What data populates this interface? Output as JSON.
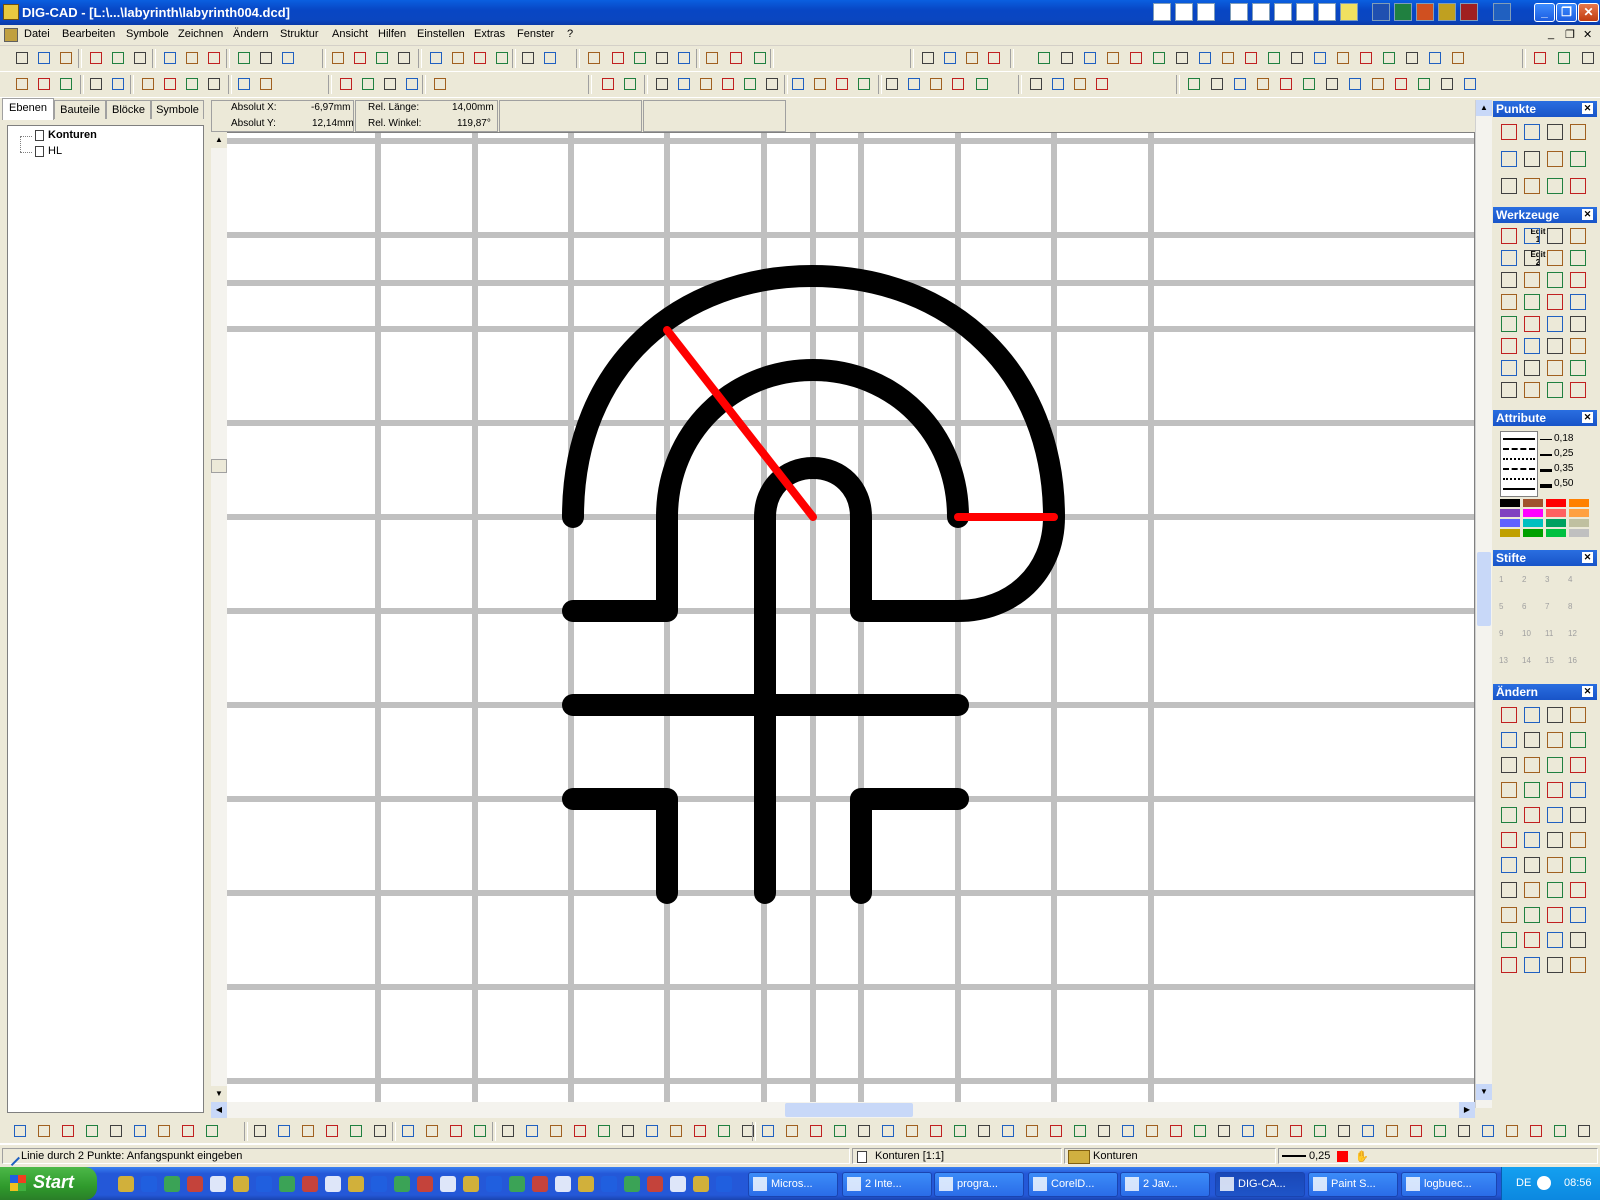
{
  "window": {
    "title": "DIG-CAD - [L:\\...\\labyrinth\\labyrinth004.dcd]",
    "controls": [
      "_",
      "❐",
      "✕"
    ]
  },
  "menu": [
    "Datei",
    "Bearbeiten",
    "Symbole",
    "Zeichnen",
    "Ändern",
    "Struktur",
    "Ansicht",
    "Hilfen",
    "Einstellen",
    "Extras",
    "Fenster",
    "?"
  ],
  "left_panel": {
    "tabs": [
      "Ebenen",
      "Bauteile",
      "Blöcke",
      "Symbole"
    ],
    "active_tab": "Ebenen",
    "layers": [
      "Konturen",
      "HL"
    ]
  },
  "coords": {
    "abs_x_label": "Absolut X:",
    "abs_x_value": "-6,97mm",
    "abs_y_label": "Absolut Y:",
    "abs_y_value": "12,14mm",
    "rel_len_label": "Rel. Länge:",
    "rel_len_value": "14,00mm",
    "rel_angle_label": "Rel. Winkel:",
    "rel_angle_value": "119,87°"
  },
  "right_panels": {
    "punkte": "Punkte",
    "werkzeuge": "Werkzeuge",
    "attribute": "Attribute",
    "stifte": "Stifte",
    "aendern": "Ändern",
    "line_widths": [
      "0,18",
      "0,25",
      "0,35",
      "0,50"
    ],
    "edit1": "Edit 1",
    "edit2": "Edit 2",
    "pen_numbers": [
      "1",
      "2",
      "3",
      "4",
      "5",
      "6",
      "7",
      "8",
      "9",
      "10",
      "11",
      "12",
      "13",
      "14",
      "15",
      "16"
    ]
  },
  "status": {
    "message": "Linie durch 2 Punkte: Anfangspunkt eingeben",
    "layer": "Konturen [1:1]",
    "active_layer": "Konturen",
    "line_width": "0,25"
  },
  "taskbar": {
    "start": "Start",
    "buttons": [
      "Micros...",
      "2 Inte...",
      "progra...",
      "CorelD...",
      "2 Jav...",
      "DIG-CA...",
      "Paint S...",
      "logbuec..."
    ],
    "active": "DIG-CA...",
    "lang": "DE",
    "clock": "08:56"
  },
  "colors": {
    "accent": "#0a46c0",
    "grid": "#c0c0c0",
    "maze": "#000000",
    "construction": "#ff0000"
  },
  "palette": [
    "#000000",
    "#a0522d",
    "#ff0000",
    "#ff8000",
    "#8040c0",
    "#ff00ff",
    "#ff6060",
    "#ffa040",
    "#6060ff",
    "#00c0c0",
    "#00a060",
    "#c0c0a0",
    "#c0a000",
    "#00a000",
    "#00c040",
    "#c0c0c0"
  ]
}
